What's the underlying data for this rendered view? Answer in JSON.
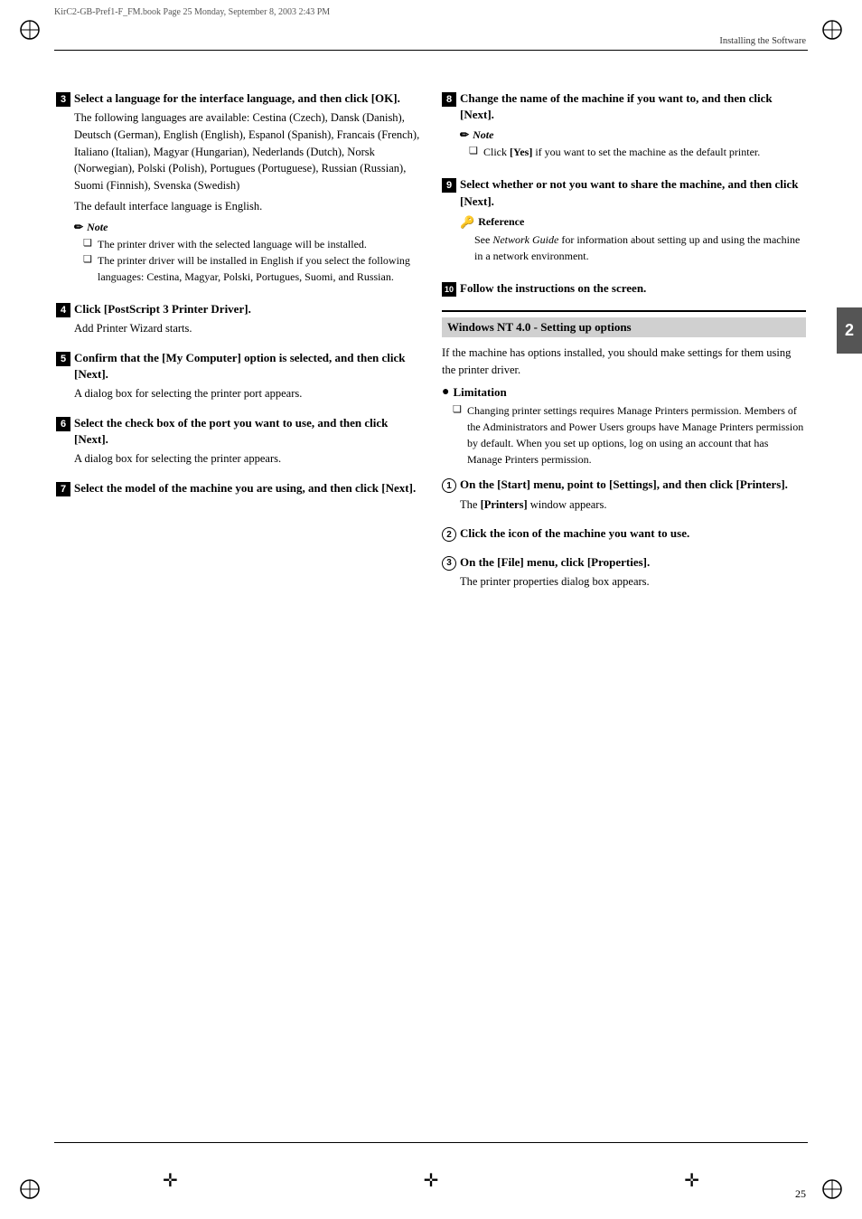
{
  "header": {
    "meta": "KirC2-GB-Pref1-F_FM.book  Page 25  Monday, September 8, 2003  2:43 PM",
    "section": "Installing the Software"
  },
  "footer": {
    "page_number": "25"
  },
  "chapter_tab": "2",
  "left_column": {
    "steps": [
      {
        "id": "3",
        "type": "square",
        "title": "Select a language for the interface language, and then click [OK].",
        "body": "The following languages are available: Cestina (Czech), Dansk (Danish), Deutsch (German), English (English), Espanol (Spanish), Francais (French), Italiano (Italian), Magyar (Hungarian), Nederlands (Dutch), Norsk (Norwegian), Polski (Polish), Portugues (Portuguese), Russian (Russian), Suomi (Finnish), Svenska (Swedish)",
        "body2": "The default interface language is English.",
        "note": {
          "title": "Note",
          "items": [
            "The printer driver with the selected language will be installed.",
            "The printer driver will be installed in English if you select the following languages: Cestina, Magyar, Polski, Portugues, Suomi, and Russian."
          ]
        }
      },
      {
        "id": "4",
        "type": "square",
        "title": "Click [PostScript 3 Printer Driver].",
        "body": "Add Printer Wizard starts."
      },
      {
        "id": "5",
        "type": "square",
        "title": "Confirm that the [My Computer] option is selected, and then click [Next].",
        "body": "A dialog box for selecting the printer port appears."
      },
      {
        "id": "6",
        "type": "square",
        "title": "Select the check box of the port you want to use, and then click [Next].",
        "body": "A dialog box for selecting the printer appears."
      },
      {
        "id": "7",
        "type": "square",
        "title": "Select the model of the machine you are using, and then click [Next]."
      }
    ]
  },
  "right_column": {
    "steps_top": [
      {
        "id": "8",
        "type": "square",
        "title": "Change the name of the machine if you want to, and then click [Next].",
        "note": {
          "title": "Note",
          "items": [
            "Click [Yes] if you want to set the machine as the default printer."
          ]
        }
      },
      {
        "id": "9",
        "type": "square",
        "title": "Select whether or not you want to share the machine, and then click [Next].",
        "reference": {
          "title": "Reference",
          "body": "See Network Guide for information about setting up and using the machine in a network environment."
        }
      },
      {
        "id": "10",
        "type": "square",
        "title": "Follow the instructions on the screen."
      }
    ],
    "section": {
      "title": "Windows NT 4.0 - Setting up options",
      "intro": "If the machine has options installed, you should make settings for them using the printer driver.",
      "limitation": {
        "title": "Limitation",
        "items": [
          "Changing printer settings requires Manage Printers permission. Members of the Administrators and Power Users groups have Manage Printers permission by default. When you set up options, log on using an account that has Manage Printers permission."
        ]
      },
      "steps": [
        {
          "id": "1",
          "type": "circle",
          "title": "On the [Start] menu, point to [Settings], and then click [Printers].",
          "body": "The [Printers] window appears."
        },
        {
          "id": "2",
          "type": "circle",
          "title": "Click the icon of the machine you want to use."
        },
        {
          "id": "3",
          "type": "circle",
          "title": "On the [File] menu, click [Properties].",
          "body": "The printer properties dialog box appears."
        }
      ]
    }
  }
}
